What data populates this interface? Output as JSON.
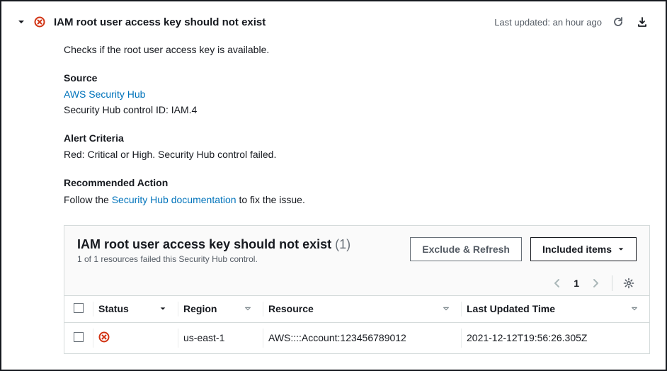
{
  "header": {
    "title": "IAM root user access key should not exist",
    "last_updated": "Last updated: an hour ago"
  },
  "description": "Checks if the root user access key is available.",
  "source": {
    "heading": "Source",
    "link_label": "AWS Security Hub",
    "control_id_line": "Security Hub control ID: IAM.4"
  },
  "alert_criteria": {
    "heading": "Alert Criteria",
    "text": "Red: Critical or High. Security Hub control failed."
  },
  "recommended_action": {
    "heading": "Recommended Action",
    "prefix": "Follow the ",
    "link_label": "Security Hub documentation",
    "suffix": " to fix the issue."
  },
  "panel": {
    "title": "IAM root user access key should not exist",
    "count_label": "(1)",
    "subtitle": "1 of 1 resources failed this Security Hub control.",
    "exclude_btn": "Exclude & Refresh",
    "included_btn": "Included items",
    "page": "1"
  },
  "table": {
    "headers": {
      "status": "Status",
      "region": "Region",
      "resource": "Resource",
      "last_updated_time": "Last Updated Time"
    },
    "rows": [
      {
        "status": "fail",
        "region": "us-east-1",
        "resource": "AWS::::Account:123456789012",
        "last_updated_time": "2021-12-12T19:56:26.305Z"
      }
    ]
  }
}
